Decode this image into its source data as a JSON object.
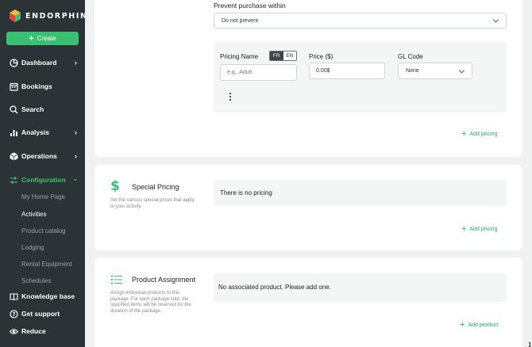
{
  "brand": {
    "name": "ENDORPHINE"
  },
  "sidebar": {
    "create_label": "Create",
    "items": [
      {
        "label": "Dashboard",
        "icon": "dashboard-icon",
        "has_chevron": true
      },
      {
        "label": "Bookings",
        "icon": "calendar-icon",
        "has_chevron": false
      },
      {
        "label": "Search",
        "icon": "search-icon",
        "has_chevron": false
      },
      {
        "label": "Analysis",
        "icon": "chart-icon",
        "has_chevron": true
      },
      {
        "label": "Operations",
        "icon": "cube-icon",
        "has_chevron": true
      },
      {
        "label": "Configuration",
        "icon": "sliders-icon",
        "has_chevron": true,
        "active": true
      }
    ],
    "config_subitems": [
      "My Home Page",
      "Activities",
      "Product catalog",
      "Lodging",
      "Rental Equipment",
      "Schedules"
    ],
    "current_subitem": "Activities",
    "bottom": [
      {
        "label": "Knowledge base",
        "icon": "book-icon"
      },
      {
        "label": "Get support",
        "icon": "help-icon"
      },
      {
        "label": "Reduce",
        "icon": "eye-icon"
      }
    ]
  },
  "pricing": {
    "prevent_label": "Prevent purchase within",
    "prevent_value": "Do not prevent",
    "pricing_name_label": "Pricing Name",
    "lang_fr": "FR",
    "lang_en": "EN",
    "pricing_name_placeholder": "e.g., Adult",
    "price_label": "Price ($)",
    "price_value": "0.00$",
    "gl_label": "GL Code",
    "gl_value": "None",
    "add_pricing": "Add pricing"
  },
  "special_pricing": {
    "title": "Special Pricing",
    "desc": "Set the various special prices that apply to your activity.",
    "empty": "There is no pricing",
    "add_pricing": "Add pricing"
  },
  "product_assignment": {
    "title": "Product Assignment",
    "desc": "Assign individual products to this package. For each package sold, the specified items will be reserved for the duration of the package.",
    "empty": "No associated product. Please add one.",
    "add_product": "Add product"
  },
  "colors": {
    "sidebar_bg": "#2b3336",
    "accent": "#3ac071",
    "page_bg": "#f0f1f1"
  }
}
